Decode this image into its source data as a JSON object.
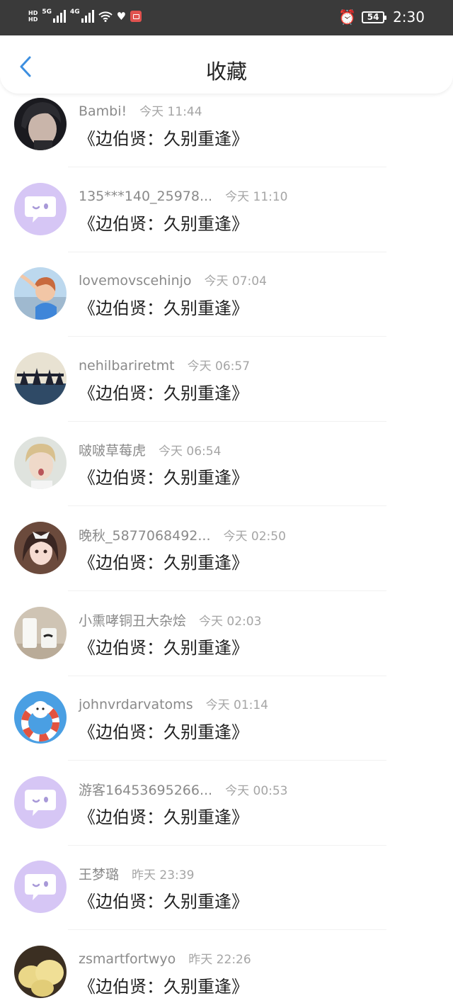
{
  "status_bar": {
    "left_badge_top": "HD",
    "left_badge_bottom": "HD",
    "net1": "5G",
    "net2": "4G",
    "battery": "54",
    "time": "2:30",
    "icons": [
      "hd-icon",
      "signal-icon",
      "wifi-icon",
      "heart-icon",
      "book-icon",
      "alarm-icon",
      "battery-icon"
    ]
  },
  "header": {
    "title": "收藏",
    "back_icon": "chevron-left-icon",
    "accent_color": "#3d8fe0"
  },
  "items": [
    {
      "name": "Bambi!",
      "time": "今天 11:44",
      "title": "《边伯贤：久别重逢》",
      "avatar": "photo-dark-portrait"
    },
    {
      "name": "135***140_25978...",
      "time": "今天 11:10",
      "title": "《边伯贤：久别重逢》",
      "avatar": "default-chat-avatar"
    },
    {
      "name": "lovemovscehinjo",
      "time": "今天 07:04",
      "title": "《边伯贤：久别重逢》",
      "avatar": "photo-girl-seaside"
    },
    {
      "name": "nehilbariretmt",
      "time": "今天 06:57",
      "title": "《边伯贤：久别重逢》",
      "avatar": "photo-silhouettes"
    },
    {
      "name": "啵啵草莓虎",
      "time": "今天 06:54",
      "title": "《边伯贤：久别重逢》",
      "avatar": "photo-boy-portrait"
    },
    {
      "name": "晚秋_5877068492...",
      "time": "今天 02:50",
      "title": "《边伯贤：久别重逢》",
      "avatar": "photo-anime-girl"
    },
    {
      "name": "小熏哮铜丑大杂烩",
      "time": "今天 02:03",
      "title": "《边伯贤：久别重逢》",
      "avatar": "photo-milk-cups"
    },
    {
      "name": "johnvrdarvatoms",
      "time": "今天 01:14",
      "title": "《边伯贤：久别重逢》",
      "avatar": "photo-bear-float"
    },
    {
      "name": "游客16453695266...",
      "time": "今天 00:53",
      "title": "《边伯贤：久别重逢》",
      "avatar": "default-chat-avatar"
    },
    {
      "name": "王梦璐",
      "time": "昨天 23:39",
      "title": "《边伯贤：久别重逢》",
      "avatar": "default-chat-avatar"
    },
    {
      "name": "zsmartfortwyo",
      "time": "昨天 22:26",
      "title": "《边伯贤：久别重逢》",
      "avatar": "photo-potatoes"
    }
  ]
}
